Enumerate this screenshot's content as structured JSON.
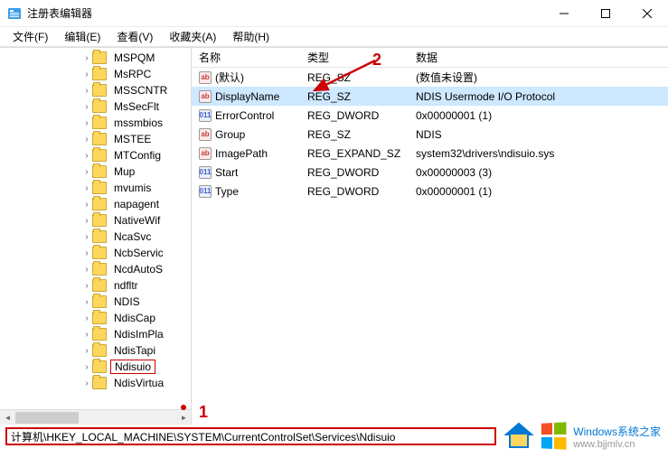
{
  "window": {
    "title": "注册表编辑器"
  },
  "menu": {
    "file": "文件(F)",
    "edit": "编辑(E)",
    "view": "查看(V)",
    "favorites": "收藏夹(A)",
    "help": "帮助(H)"
  },
  "tree": {
    "items": [
      {
        "label": "MSPQM",
        "indent": 1
      },
      {
        "label": "MsRPC",
        "indent": 1
      },
      {
        "label": "MSSCNTR",
        "indent": 1
      },
      {
        "label": "MsSecFlt",
        "indent": 1
      },
      {
        "label": "mssmbios",
        "indent": 1
      },
      {
        "label": "MSTEE",
        "indent": 1
      },
      {
        "label": "MTConfig",
        "indent": 1
      },
      {
        "label": "Mup",
        "indent": 1
      },
      {
        "label": "mvumis",
        "indent": 1
      },
      {
        "label": "napagent",
        "indent": 1
      },
      {
        "label": "NativeWif",
        "indent": 1
      },
      {
        "label": "NcaSvc",
        "indent": 1
      },
      {
        "label": "NcbServic",
        "indent": 1
      },
      {
        "label": "NcdAutoS",
        "indent": 1
      },
      {
        "label": "ndfltr",
        "indent": 1
      },
      {
        "label": "NDIS",
        "indent": 1
      },
      {
        "label": "NdisCap",
        "indent": 1
      },
      {
        "label": "NdisImPla",
        "indent": 1
      },
      {
        "label": "NdisTapi",
        "indent": 1
      },
      {
        "label": "Ndisuio",
        "indent": 1,
        "selected": true
      },
      {
        "label": "NdisVirtua",
        "indent": 1
      }
    ]
  },
  "list": {
    "headers": {
      "name": "名称",
      "type": "类型",
      "data": "数据"
    },
    "rows": [
      {
        "icon": "str",
        "name": "(默认)",
        "type": "REG_SZ",
        "data": "(数值未设置)"
      },
      {
        "icon": "str",
        "name": "DisplayName",
        "type": "REG_SZ",
        "data": "NDIS Usermode I/O Protocol",
        "selected": true
      },
      {
        "icon": "bin",
        "name": "ErrorControl",
        "type": "REG_DWORD",
        "data": "0x00000001 (1)"
      },
      {
        "icon": "str",
        "name": "Group",
        "type": "REG_SZ",
        "data": "NDIS"
      },
      {
        "icon": "str",
        "name": "ImagePath",
        "type": "REG_EXPAND_SZ",
        "data": "system32\\drivers\\ndisuio.sys"
      },
      {
        "icon": "bin",
        "name": "Start",
        "type": "REG_DWORD",
        "data": "0x00000003 (3)"
      },
      {
        "icon": "bin",
        "name": "Type",
        "type": "REG_DWORD",
        "data": "0x00000001 (1)"
      }
    ]
  },
  "statusbar": {
    "path": "计算机\\HKEY_LOCAL_MACHINE\\SYSTEM\\CurrentControlSet\\Services\\Ndisuio"
  },
  "annotations": {
    "one": "1",
    "two": "2"
  },
  "watermark": {
    "brand": "Windows",
    "brand_cn": "系统之家",
    "url": "www.bjjmlv.cn"
  }
}
